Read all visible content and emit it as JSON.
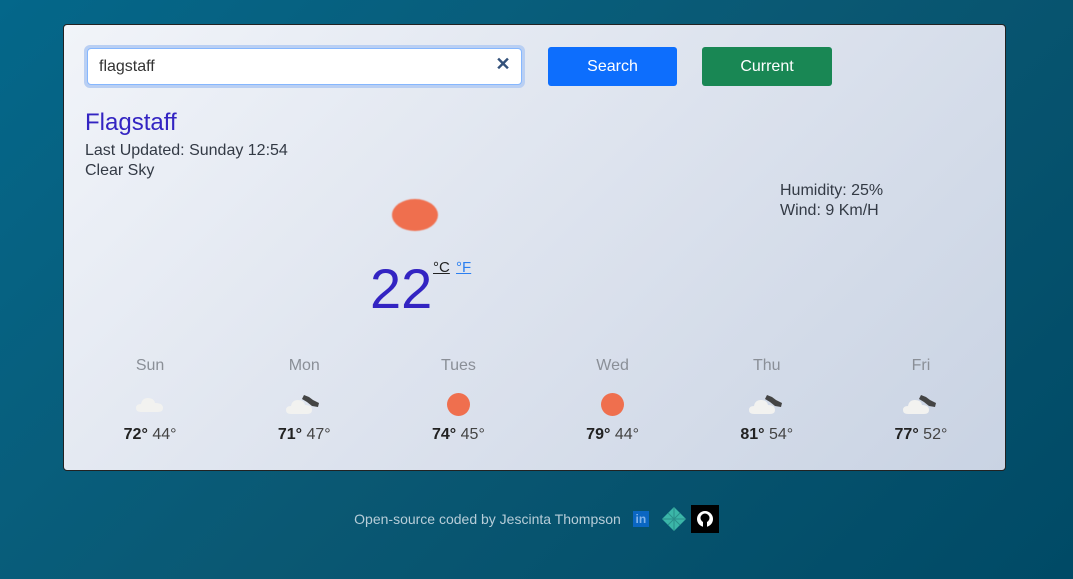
{
  "search": {
    "value": "flagstaff",
    "clear_icon": "close-icon",
    "search_label": "Search",
    "current_label": "Current"
  },
  "current": {
    "city": "Flagstaff",
    "last_updated": "Last Updated: Sunday 12:54",
    "description": "Clear Sky",
    "icon": "sun-icon",
    "temperature": "22",
    "unit_celsius": "°C",
    "unit_fahrenheit": "°F",
    "humidity": "Humidity: 25%",
    "wind": "Wind: 9 Km/H"
  },
  "forecast": [
    {
      "day": "Sun",
      "icon": "cloud-icon",
      "high": "72°",
      "low": "44°"
    },
    {
      "day": "Mon",
      "icon": "partly-cloudy-dark-icon",
      "high": "71°",
      "low": "47°"
    },
    {
      "day": "Tues",
      "icon": "sun-icon",
      "high": "74°",
      "low": "45°"
    },
    {
      "day": "Wed",
      "icon": "sun-icon",
      "high": "79°",
      "low": "44°"
    },
    {
      "day": "Thu",
      "icon": "partly-cloudy-dark-icon",
      "high": "81°",
      "low": "54°"
    },
    {
      "day": "Fri",
      "icon": "partly-cloudy-dark-icon",
      "high": "77°",
      "low": "52°"
    }
  ],
  "footer": {
    "text": "Open-source coded by Jescinta Thompson",
    "links": [
      "linkedin-icon",
      "netlify-icon",
      "github-icon"
    ]
  },
  "colors": {
    "accent": "#3324c2",
    "search_button": "#0d6efd",
    "current_button": "#198754",
    "sun": "#ef6f4e"
  }
}
